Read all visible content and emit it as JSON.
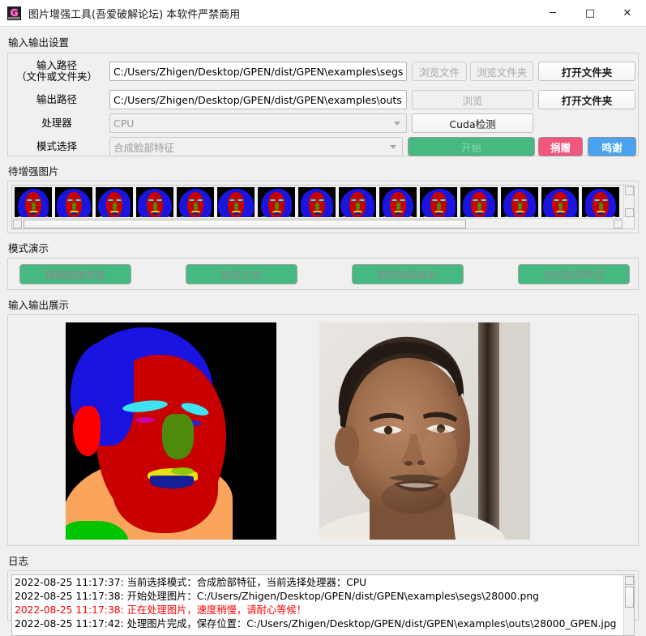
{
  "window": {
    "title": "图片增强工具(吾爱破解论坛) 本软件严禁商用",
    "icon_letter": "G",
    "minimize": "─",
    "maximize": "□",
    "close": "✕"
  },
  "io_settings": {
    "group_title": "输入输出设置",
    "rows": [
      {
        "label_line1": "输入路径",
        "label_line2": "（文件或文件夹）",
        "value": "C:/Users/Zhigen/Desktop/GPEN/dist/GPEN\\examples\\segs",
        "buttons": [
          {
            "label": "浏览文件",
            "state": "disabled"
          },
          {
            "label": "浏览文件夹",
            "state": "disabled"
          },
          {
            "label": "打开文件夹",
            "state": "enabled"
          }
        ]
      },
      {
        "label_line1": "输出路径",
        "label_line2": "",
        "value": "C:/Users/Zhigen/Desktop/GPEN/dist/GPEN\\examples\\outs",
        "buttons": [
          {
            "label": "浏览",
            "state": "disabled"
          },
          {
            "label": "打开文件夹",
            "state": "enabled"
          }
        ]
      },
      {
        "label_line1": "处理器",
        "label_line2": "",
        "value": "CPU",
        "buttons": [
          {
            "label": "Cuda检测",
            "state": "enabled"
          }
        ]
      },
      {
        "label_line1": "模式选择",
        "label_line2": "",
        "value": "合成脸部特征",
        "buttons": [
          {
            "label": "开始",
            "state": "disabled"
          },
          {
            "label": "捐赠",
            "state": "enabled"
          },
          {
            "label": "鸣谢",
            "state": "enabled"
          }
        ]
      }
    ]
  },
  "thumbnails": {
    "group_title": "待增强图片",
    "count": 15,
    "scroll_h_percent": 75
  },
  "mode_demo": {
    "group_title": "模式演示",
    "buttons": [
      {
        "label": "模糊图像修复"
      },
      {
        "label": "脸部上色"
      },
      {
        "label": "脸部缺陷修补"
      },
      {
        "label": "合成脸部特征"
      }
    ]
  },
  "display": {
    "group_title": "输入输出展示",
    "input_image_alt": "面部语义分割图",
    "output_image_alt": "生成的人脸照片"
  },
  "log": {
    "group_title": "日志",
    "lines": [
      {
        "text": "2022-08-25 11:17:37: 当前选择模式：合成脸部特征，当前选择处理器：CPU",
        "level": "info"
      },
      {
        "text": "2022-08-25 11:17:38: 开始处理图片：C:/Users/Zhigen/Desktop/GPEN/dist/GPEN\\examples\\segs\\28000.png",
        "level": "info"
      },
      {
        "text": "2022-08-25 11:17:38: 正在处理图片，速度稍慢，请耐心等候！",
        "level": "error"
      },
      {
        "text": "2022-08-25 11:17:42: 处理图片完成，保存位置：C:/Users/Zhigen/Desktop/GPEN/dist/GPEN\\examples\\outs\\28000_GPEN.jpg",
        "level": "info"
      }
    ]
  },
  "colors": {
    "accent_green": "#46b983",
    "accent_pink": "#f2567f",
    "accent_blue": "#4aa3ef",
    "error_red": "#ff0000",
    "window_bg": "#f0f0f0"
  }
}
